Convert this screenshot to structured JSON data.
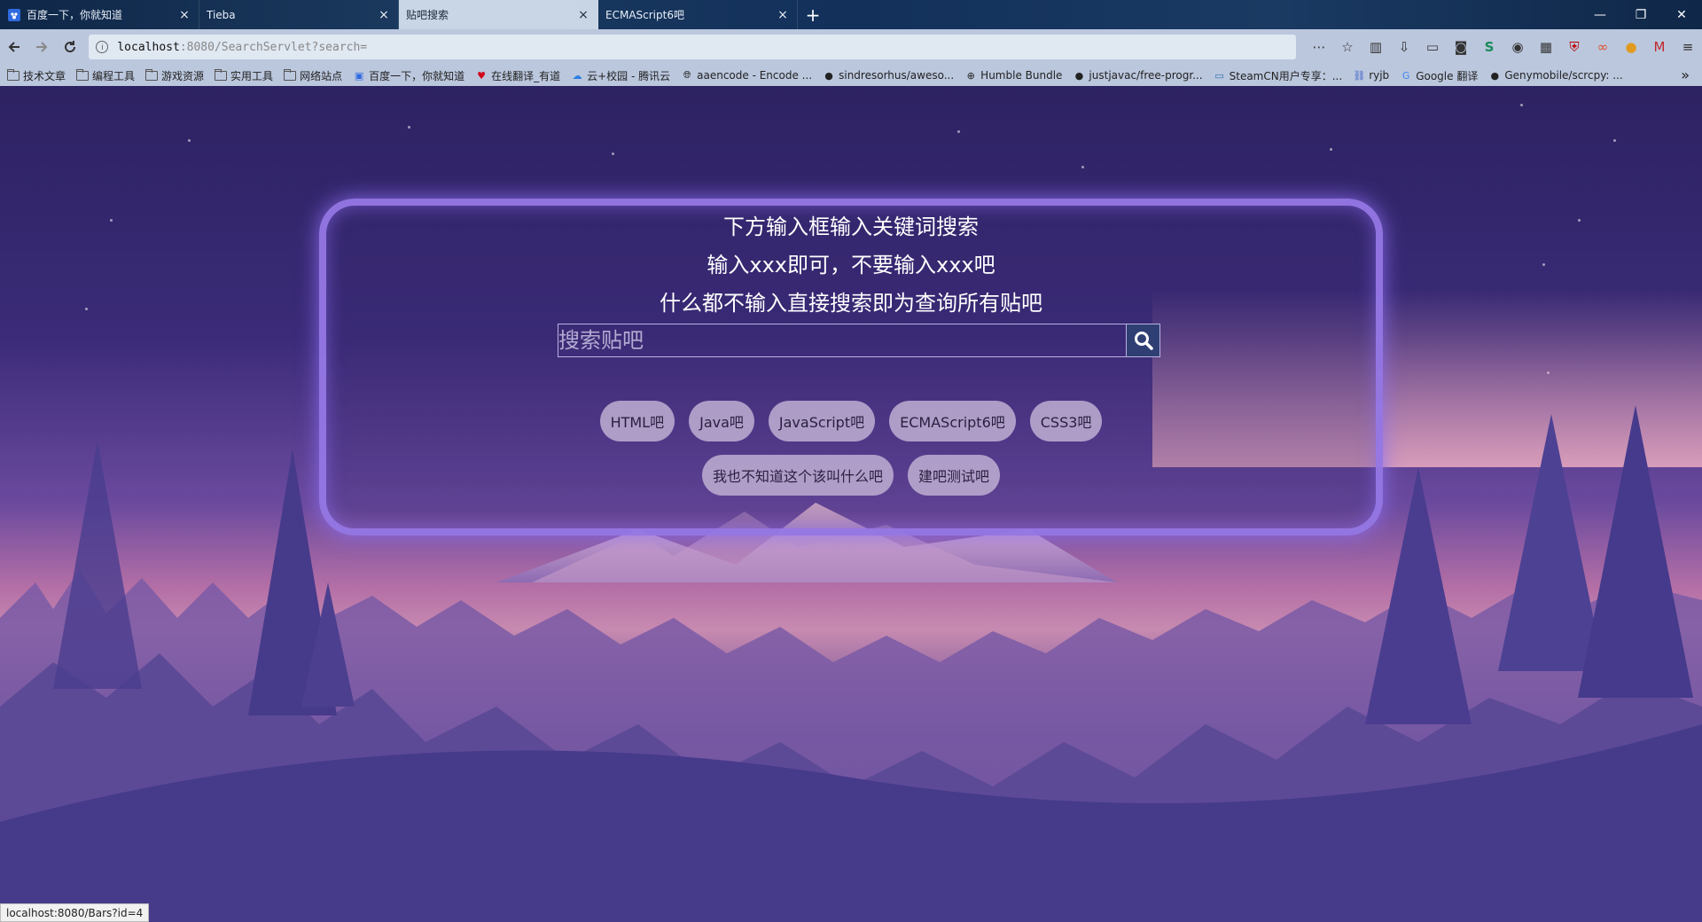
{
  "tabs": [
    {
      "label": "百度一下，你就知道",
      "icon": "baidu-icon",
      "active": false
    },
    {
      "label": "Tieba",
      "icon": "",
      "active": false
    },
    {
      "label": "贴吧搜索",
      "icon": "",
      "active": true
    },
    {
      "label": "ECMAScript6吧",
      "icon": "",
      "active": false
    }
  ],
  "address": {
    "host": "localhost",
    "path": ":8080/SearchServlet?search="
  },
  "bookmarks": [
    {
      "label": "技术文章",
      "icon": "folder-icon"
    },
    {
      "label": "编程工具",
      "icon": "folder-icon"
    },
    {
      "label": "游戏资源",
      "icon": "folder-icon"
    },
    {
      "label": "实用工具",
      "icon": "folder-icon"
    },
    {
      "label": "网络站点",
      "icon": "folder-icon"
    },
    {
      "label": "百度一下，你就知道",
      "icon": "baidu-icon"
    },
    {
      "label": "在线翻译_有道",
      "icon": "youdao-icon"
    },
    {
      "label": "云+校园 - 腾讯云",
      "icon": "tencent-cloud-icon"
    },
    {
      "label": "aaencode - Encode ...",
      "icon": "globe-icon"
    },
    {
      "label": "sindresorhus/aweso...",
      "icon": "github-icon"
    },
    {
      "label": "Humble Bundle",
      "icon": "globe-icon"
    },
    {
      "label": "justjavac/free-progr...",
      "icon": "github-icon"
    },
    {
      "label": "SteamCN用户专享：...",
      "icon": "steamcn-icon"
    },
    {
      "label": "ryjb",
      "icon": "link-icon"
    },
    {
      "label": "Google 翻译",
      "icon": "google-translate-icon"
    },
    {
      "label": "Genymobile/scrcpy: ...",
      "icon": "github-icon"
    }
  ],
  "hints": [
    "下方输入框输入关键词搜索",
    "输入xxx即可，不要输入xxx吧",
    "什么都不输入直接搜索即为查询所有贴吧"
  ],
  "search": {
    "placeholder": "搜索贴吧",
    "value": ""
  },
  "bars_row1": [
    "HTML吧",
    "Java吧",
    "JavaScript吧",
    "ECMAScript6吧",
    "CSS3吧"
  ],
  "bars_row2": [
    "我也不知道这个该叫什么吧",
    "建吧测试吧"
  ],
  "status_text": "localhost:8080/Bars?id=4",
  "colors": {
    "panel_border": "#9678e6",
    "search_button": "#2f3f74",
    "chip_bg": "#beafd2"
  }
}
